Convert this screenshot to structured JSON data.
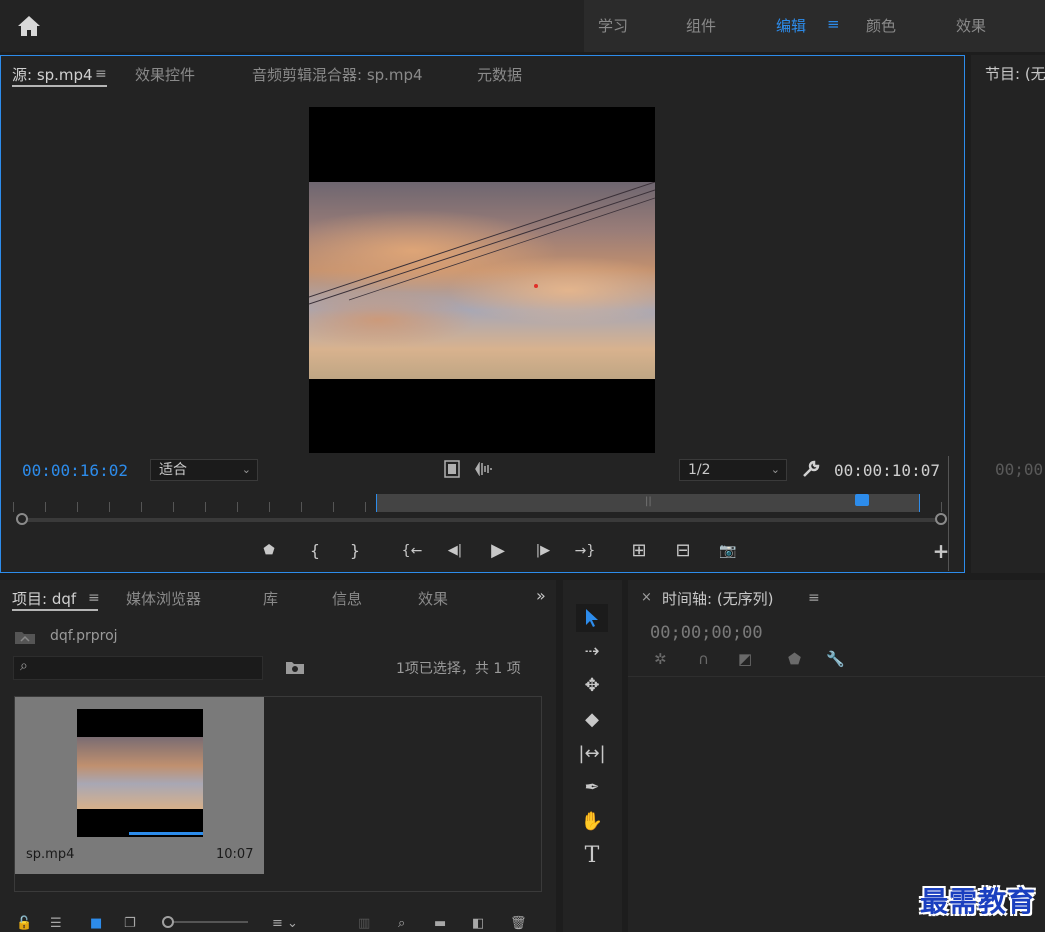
{
  "workspaces": {
    "tabs": [
      "学习",
      "组件",
      "编辑",
      "颜色",
      "效果"
    ],
    "active": "编辑",
    "menu_glyph": "≡"
  },
  "source": {
    "tabs": [
      "源: sp.mp4",
      "效果控件",
      "音频剪辑混合器: sp.mp4",
      "元数据"
    ],
    "hamb": "≡",
    "timecode_current": "00:00:16:02",
    "zoom_value": "适合",
    "resolution_value": "1/2",
    "timecode_duration": "00:00:10:07",
    "controls": {
      "marker": "⬟",
      "mark_in": "{",
      "mark_out": "}",
      "go_to_in": "{←",
      "step_back": "◀|",
      "play": "▶",
      "step_forward": "|▶",
      "go_to_out": "→}",
      "insert": "⊞",
      "overwrite": "⊟",
      "export_frame": "📷",
      "add": "+"
    }
  },
  "program": {
    "tab_partial": "节目: (无",
    "timecode_partial": "00;00;"
  },
  "project": {
    "tabs": [
      "项目: dqf",
      "媒体浏览器",
      "库",
      "信息",
      "效果"
    ],
    "hamb": "≡",
    "more": "»",
    "file_name": "dqf.prproj",
    "selection_status": "1项已选择，共 1 项",
    "clip": {
      "name": "sp.mp4",
      "duration": "10:07"
    }
  },
  "timeline": {
    "close": "×",
    "title": "时间轴: (无序列)",
    "hamb": "≡",
    "timecode": "00;00;00;00"
  },
  "watermark": "最需教育",
  "colors": {
    "accent": "#2d8ceb",
    "panel_bg": "#232323",
    "app_bg": "#1d1d1d"
  }
}
